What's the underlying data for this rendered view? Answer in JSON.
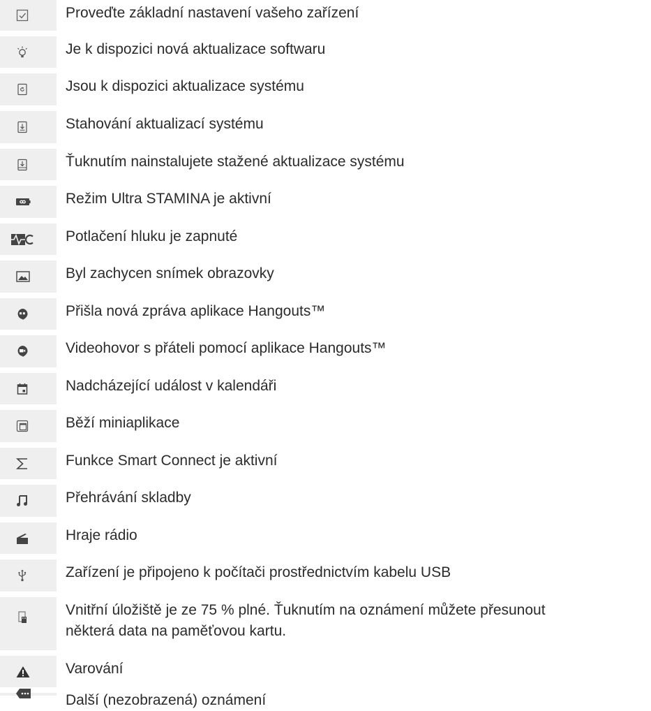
{
  "colors": {
    "icon_cell_bg": "#efefef",
    "text": "#2b2b2b",
    "icon": "#555555"
  },
  "rows": [
    {
      "icon": "checkbox-icon",
      "text": "Proveďte základní nastavení vašeho zařízení"
    },
    {
      "icon": "lightbulb-icon",
      "text": "Je k dispozici nová aktualizace softwaru"
    },
    {
      "icon": "system-update-icon",
      "text": "Jsou k dispozici aktualizace systému"
    },
    {
      "icon": "download-update-icon",
      "text": "Stahování aktualizací systému"
    },
    {
      "icon": "install-update-icon",
      "text": "Ťuknutím nainstalujete stažené aktualizace systému"
    },
    {
      "icon": "ultra-stamina-icon",
      "text": "Režim Ultra STAMINA je aktivní"
    },
    {
      "icon": "noise-cancelling-icon",
      "text": "Potlačení hluku je zapnuté"
    },
    {
      "icon": "screenshot-icon",
      "text": "Byl zachycen snímek obrazovky"
    },
    {
      "icon": "hangouts-message-icon",
      "text": "Přišla nová zpráva aplikace Hangouts™"
    },
    {
      "icon": "hangouts-video-icon",
      "text": "Videohovor s přáteli pomocí aplikace Hangouts™"
    },
    {
      "icon": "calendar-icon",
      "text": "Nadcházející událost v kalendáři"
    },
    {
      "icon": "mini-apps-icon",
      "text": "Běží miniaplikace"
    },
    {
      "icon": "smart-connect-icon",
      "text": "Funkce Smart Connect je aktivní"
    },
    {
      "icon": "music-note-icon",
      "text": "Přehrávání skladby"
    },
    {
      "icon": "radio-icon",
      "text": "Hraje rádio"
    },
    {
      "icon": "usb-icon",
      "text": "Zařízení je připojeno k počítači prostřednictvím kabelu USB"
    },
    {
      "icon": "storage-icon",
      "text": "Vnitřní úložiště je ze 75 % plné. Ťuknutím na oznámení můžete přesunout\nněkterá data na paměťovou kartu."
    },
    {
      "icon": "warning-icon",
      "text": "Varování"
    },
    {
      "icon": "more-notifications-icon",
      "text": "Další (nezobrazená) oznámení"
    }
  ]
}
